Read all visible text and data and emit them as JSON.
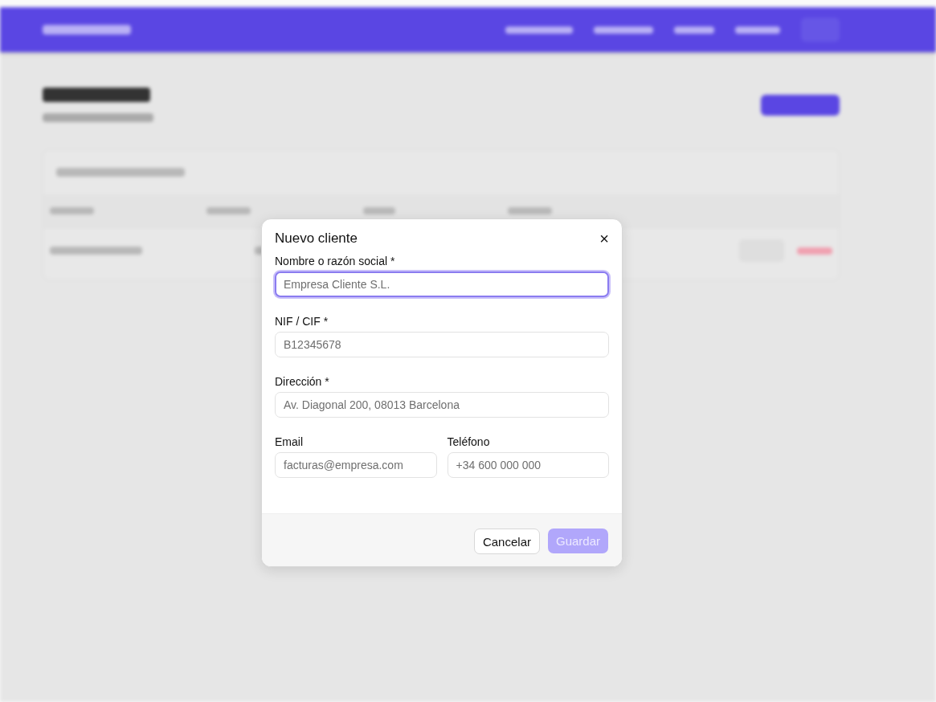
{
  "dialog": {
    "title": "Nuevo cliente",
    "close": "×",
    "fields": [
      {
        "label": "Nombre o razón social *",
        "placeholder": "Empresa Cliente S.L.",
        "focused": true,
        "half": false
      },
      {
        "label": "NIF / CIF *",
        "placeholder": "B12345678",
        "focused": false,
        "half": false
      },
      {
        "label": "Dirección *",
        "placeholder": "Av. Diagonal 200, 08013 Barcelona",
        "focused": false,
        "half": false
      },
      {
        "label": "Email",
        "placeholder": "facturas@empresa.com",
        "focused": false,
        "half": true
      },
      {
        "label": "Teléfono",
        "placeholder": "+34 600 000 000",
        "focused": false,
        "half": true
      }
    ],
    "cancel": "Cancelar",
    "save": {
      "label": "Guardar",
      "disabled": true
    }
  }
}
